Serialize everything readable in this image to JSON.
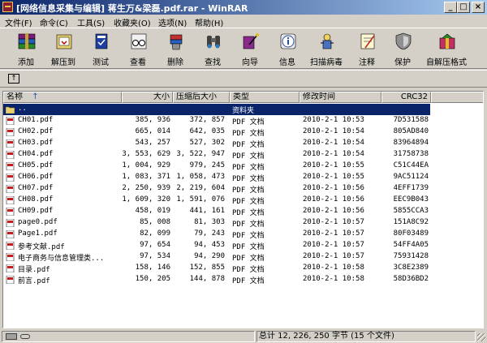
{
  "window": {
    "title": "[网络信息采集与编辑] 蒋生万&梁磊.pdf.rar - WinRAR",
    "min_label": "_",
    "max_label": "□",
    "close_label": "×"
  },
  "menu": [
    "文件(F)",
    "命令(C)",
    "工具(S)",
    "收藏夹(O)",
    "选项(N)",
    "帮助(H)"
  ],
  "toolbar": [
    {
      "label": "添加",
      "icon": "books-stack-icon"
    },
    {
      "label": "解压到",
      "icon": "folder-extract-icon"
    },
    {
      "label": "测试",
      "icon": "test-book-icon"
    },
    {
      "label": "查看",
      "icon": "view-glasses-icon"
    },
    {
      "label": "删除",
      "icon": "delete-trash-icon"
    },
    {
      "label": "查找",
      "icon": "binoculars-icon"
    },
    {
      "label": "向导",
      "icon": "wizard-icon"
    },
    {
      "label": "信息",
      "icon": "info-icon"
    },
    {
      "label": "扫描病毒",
      "icon": "virus-scan-icon"
    },
    {
      "label": "注释",
      "icon": "comment-icon"
    },
    {
      "label": "保护",
      "icon": "shield-icon"
    },
    {
      "label": "自解压格式",
      "icon": "sfx-box-icon"
    }
  ],
  "columns": {
    "name": "名称",
    "size": "大小",
    "packed": "压缩后大小",
    "type": "类型",
    "modified": "修改时间",
    "crc": "CRC32"
  },
  "parent_row": {
    "name": "..",
    "type": "资料夹"
  },
  "files": [
    {
      "name": "CH01.pdf",
      "size": "385, 936",
      "packed": "372, 857",
      "type": "PDF 文档",
      "modified": "2010-2-1 10:53",
      "crc": "7D531588"
    },
    {
      "name": "CH02.pdf",
      "size": "665, 014",
      "packed": "642, 035",
      "type": "PDF 文档",
      "modified": "2010-2-1 10:54",
      "crc": "805AD840"
    },
    {
      "name": "CH03.pdf",
      "size": "543, 257",
      "packed": "527, 302",
      "type": "PDF 文档",
      "modified": "2010-2-1 10:54",
      "crc": "83964894"
    },
    {
      "name": "CH04.pdf",
      "size": "3, 553, 629",
      "packed": "3, 522, 947",
      "type": "PDF 文档",
      "modified": "2010-2-1 10:54",
      "crc": "31758738"
    },
    {
      "name": "CH05.pdf",
      "size": "1, 004, 929",
      "packed": "979, 245",
      "type": "PDF 文档",
      "modified": "2010-2-1 10:55",
      "crc": "C51C44EA"
    },
    {
      "name": "CH06.pdf",
      "size": "1, 083, 371",
      "packed": "1, 058, 473",
      "type": "PDF 文档",
      "modified": "2010-2-1 10:55",
      "crc": "9AC51124"
    },
    {
      "name": "CH07.pdf",
      "size": "2, 250, 939",
      "packed": "2, 219, 604",
      "type": "PDF 文档",
      "modified": "2010-2-1 10:56",
      "crc": "4EFF1739"
    },
    {
      "name": "CH08.pdf",
      "size": "1, 609, 320",
      "packed": "1, 591, 076",
      "type": "PDF 文档",
      "modified": "2010-2-1 10:56",
      "crc": "EEC9B043"
    },
    {
      "name": "CH09.pdf",
      "size": "458, 019",
      "packed": "441, 161",
      "type": "PDF 文档",
      "modified": "2010-2-1 10:56",
      "crc": "5855CCA3"
    },
    {
      "name": "page0.pdf",
      "size": "85, 008",
      "packed": "81, 303",
      "type": "PDF 文档",
      "modified": "2010-2-1 10:57",
      "crc": "151A8C92"
    },
    {
      "name": "Page1.pdf",
      "size": "82, 099",
      "packed": "79, 243",
      "type": "PDF 文档",
      "modified": "2010-2-1 10:57",
      "crc": "80F03489"
    },
    {
      "name": "参考文献.pdf",
      "size": "97, 654",
      "packed": "94, 453",
      "type": "PDF 文档",
      "modified": "2010-2-1 10:57",
      "crc": "54FF4A05"
    },
    {
      "name": "电子商务与信息管理类...",
      "size": "97, 534",
      "packed": "94, 290",
      "type": "PDF 文档",
      "modified": "2010-2-1 10:57",
      "crc": "75931428"
    },
    {
      "name": "目录.pdf",
      "size": "158, 146",
      "packed": "152, 855",
      "type": "PDF 文档",
      "modified": "2010-2-1 10:58",
      "crc": "3C8E2389"
    },
    {
      "name": "前言.pdf",
      "size": "150, 205",
      "packed": "144, 878",
      "type": "PDF 文档",
      "modified": "2010-2-1 10:58",
      "crc": "58D36BD2"
    }
  ],
  "status": {
    "total": "总计 12, 226, 250 字节 (15 个文件)"
  },
  "colors": {
    "titlebar_start": "#0a246a",
    "titlebar_end": "#a6caf0",
    "selection": "#0a246a",
    "chrome": "#d4d0c8"
  }
}
